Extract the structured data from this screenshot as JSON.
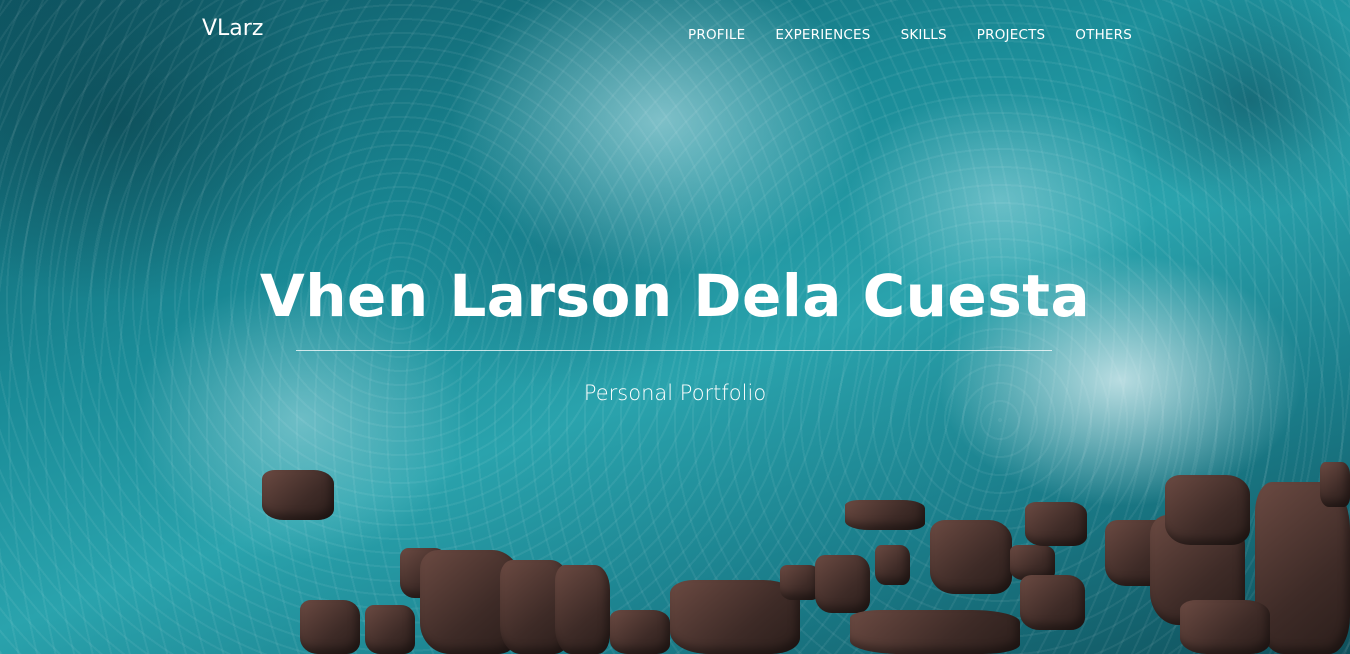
{
  "brand": "VLarz",
  "nav": {
    "items": [
      {
        "label": "PROFILE"
      },
      {
        "label": "EXPERIENCES"
      },
      {
        "label": "SKILLS"
      },
      {
        "label": "PROJECTS"
      },
      {
        "label": "OTHERS"
      }
    ]
  },
  "hero": {
    "title": "Vhen Larson Dela Cuesta",
    "subtitle": "Personal Portfolio"
  },
  "colors": {
    "text": "#ffffff",
    "water": "#1a8b97",
    "rock": "#3e2b27"
  }
}
